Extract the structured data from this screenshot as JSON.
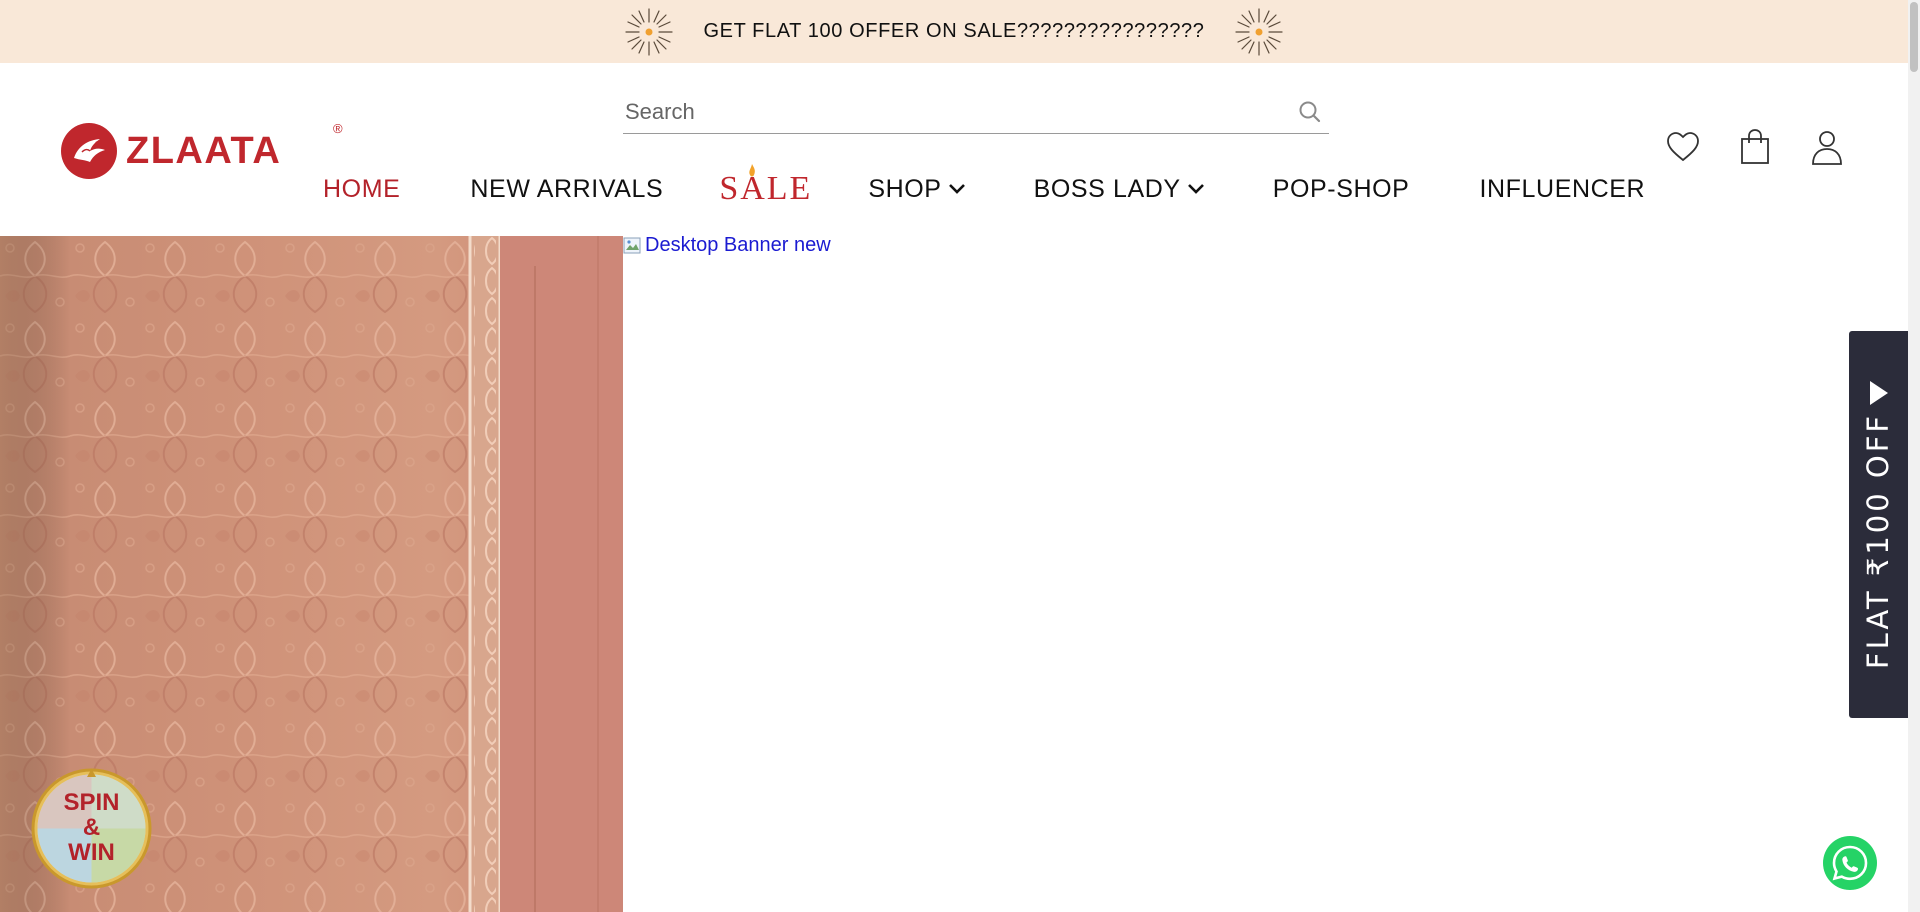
{
  "announcement": {
    "text": "GET FLAT 100 OFFER ON SALE????????????????"
  },
  "header": {
    "logo_text": "ZLAATA",
    "logo_reg": "®",
    "search": {
      "placeholder": "Search",
      "value": ""
    },
    "nav": [
      {
        "label": "HOME",
        "active": true
      },
      {
        "label": "NEW ARRIVALS"
      },
      {
        "label": "SALE"
      },
      {
        "label": "SHOP",
        "dropdown": true
      },
      {
        "label": "BOSS LADY",
        "dropdown": true
      },
      {
        "label": "POP-SHOP"
      },
      {
        "label": "INFLUENCER"
      }
    ],
    "icons": [
      "heart-icon",
      "shopping-bag-icon",
      "user-icon"
    ]
  },
  "hero": {
    "banner_alt": "Desktop Banner new"
  },
  "side_tab": {
    "text": "FLAT ₹100 OFF"
  },
  "spin_win": {
    "line1": "SPIN",
    "line2": "&",
    "line3": "WIN"
  },
  "colors": {
    "brand_red": "#c0272d",
    "announce_bg": "#f9e8d8",
    "side_tab_bg": "#2b2c3a",
    "whatsapp_green": "#25d366",
    "link_blue": "#1b1bd1"
  }
}
